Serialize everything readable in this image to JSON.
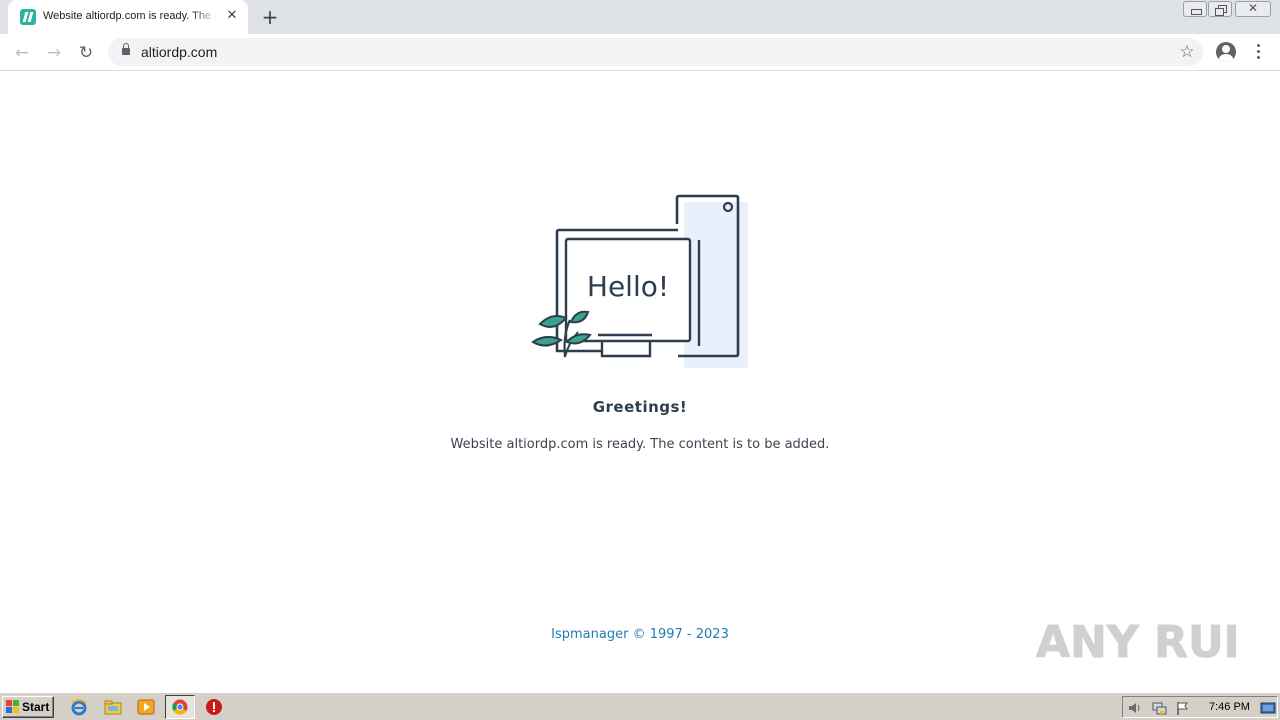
{
  "browser": {
    "tab": {
      "title": "Website altiordp.com is ready. The content is to be added.",
      "close_glyph": "✕"
    },
    "new_tab_glyph": "+",
    "window_close_glyph": "✕",
    "address_bar": {
      "url": "altiordp.com"
    },
    "icons": {
      "back": "←",
      "forward": "→",
      "reload": "↻",
      "bookmark": "☆"
    }
  },
  "page": {
    "illustration_text": "Hello!",
    "heading": "Greetings!",
    "message": "Website altiordp.com is ready. The content is to be added.",
    "footer": "Ispmanager © 1997 - 2023",
    "watermark": "ANY RUN"
  },
  "taskbar": {
    "start_label": "Start",
    "clock": "7:46 PM"
  },
  "colors": {
    "illustration_stroke": "#2f3e4e",
    "leaf_green": "#3aa38c",
    "screen_fill": "#e9f0fb",
    "footer_link": "#1e7db8"
  }
}
